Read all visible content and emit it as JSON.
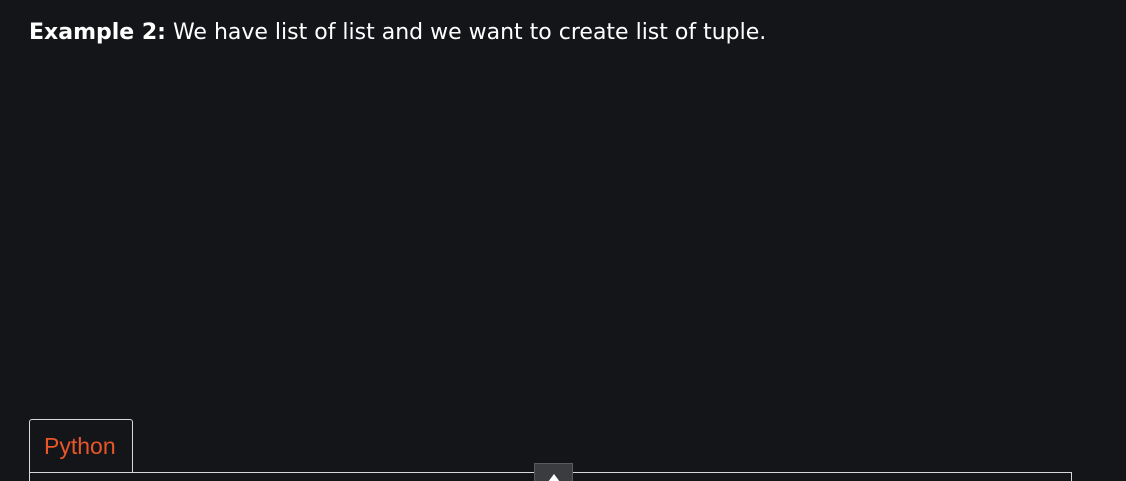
{
  "intro": {
    "label": "Example 2:",
    "text": " We have list of list and we want to create list of tuple."
  },
  "code_block": {
    "tab_label": "Python"
  },
  "icons": {
    "scroll_up": "chevron-up-icon"
  },
  "colors": {
    "background": "#141518",
    "text": "#ffffff",
    "tab_text": "#e8562a",
    "border": "#d8d8d8",
    "scroll_button": "#3b3c40"
  }
}
